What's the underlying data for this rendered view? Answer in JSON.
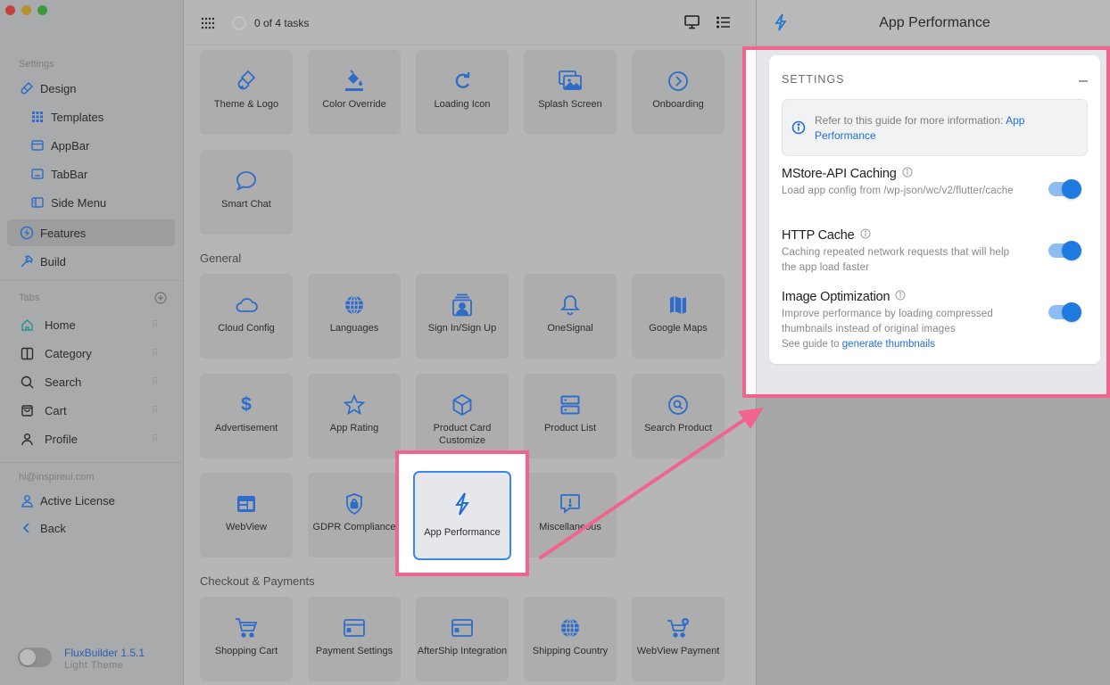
{
  "window": {
    "traffic_lights": [
      "close",
      "minimize",
      "zoom"
    ]
  },
  "sidebar": {
    "settings_label": "Settings",
    "items": [
      {
        "label": "Design",
        "icon": "brush-icon",
        "level": 1,
        "active": false
      },
      {
        "label": "Templates",
        "icon": "grid-icon",
        "level": 2,
        "active": false
      },
      {
        "label": "AppBar",
        "icon": "appbar-icon",
        "level": 2,
        "active": false
      },
      {
        "label": "TabBar",
        "icon": "tabbar-icon",
        "level": 2,
        "active": false
      },
      {
        "label": "Side Menu",
        "icon": "side-menu-icon",
        "level": 2,
        "active": false
      },
      {
        "label": "Features",
        "icon": "bolt-circle-icon",
        "level": 1,
        "active": true
      },
      {
        "label": "Build",
        "icon": "hammer-icon",
        "level": 1,
        "active": false
      }
    ],
    "tabs_label": "Tabs",
    "tabs": [
      {
        "label": "Home",
        "icon": "home-icon"
      },
      {
        "label": "Category",
        "icon": "category-icon"
      },
      {
        "label": "Search",
        "icon": "search-icon"
      },
      {
        "label": "Cart",
        "icon": "cart-icon"
      },
      {
        "label": "Profile",
        "icon": "profile-icon"
      }
    ],
    "email": "hi@inspireui.com",
    "account_items": [
      {
        "label": "Active License",
        "icon": "user-icon"
      },
      {
        "label": "Back",
        "icon": "chevron-left-icon"
      }
    ],
    "app_version": "FluxBuilder 1.5.1",
    "theme_label": "Light Theme",
    "theme_toggle_on": false
  },
  "toolbar": {
    "tasks_text": "0 of 4 tasks",
    "tasks_done": 0,
    "tasks_total": 4
  },
  "main": {
    "design_cards": [
      {
        "label": "Theme & Logo",
        "icon": "brush-icon"
      },
      {
        "label": "Color Override",
        "icon": "paint-bucket-icon"
      },
      {
        "label": "Loading Icon",
        "icon": "refresh-icon"
      },
      {
        "label": "Splash Screen",
        "icon": "images-icon"
      },
      {
        "label": "Onboarding",
        "icon": "arrow-circle-icon"
      },
      {
        "label": "Smart Chat",
        "icon": "chat-icon"
      }
    ],
    "general_label": "General",
    "general_cards": [
      {
        "label": "Cloud Config",
        "icon": "cloud-icon"
      },
      {
        "label": "Languages",
        "icon": "globe-icon"
      },
      {
        "label": "Sign In/Sign Up",
        "icon": "user-card-icon"
      },
      {
        "label": "OneSignal",
        "icon": "bell-icon"
      },
      {
        "label": "Google Maps",
        "icon": "map-icon"
      },
      {
        "label": "Advertisement",
        "icon": "dollar-icon"
      },
      {
        "label": "App Rating",
        "icon": "star-icon"
      },
      {
        "label": "Product Card Customize",
        "icon": "box-icon"
      },
      {
        "label": "Product List",
        "icon": "server-list-icon"
      },
      {
        "label": "Search Product",
        "icon": "search-circle-icon"
      },
      {
        "label": "WebView",
        "icon": "webview-icon"
      },
      {
        "label": "GDPR Compliance",
        "icon": "shield-lock-icon"
      },
      {
        "label": "App Performance",
        "icon": "bolt-icon",
        "selected": true
      },
      {
        "label": "Miscellaneous",
        "icon": "alert-bubble-icon"
      }
    ],
    "checkout_label": "Checkout & Payments",
    "checkout_cards": [
      {
        "label": "Shopping Cart",
        "icon": "cart-icon"
      },
      {
        "label": "Payment Settings",
        "icon": "credit-card-icon"
      },
      {
        "label": "AfterShip Integration",
        "icon": "credit-card-icon"
      },
      {
        "label": "Shipping Country",
        "icon": "globe-icon"
      },
      {
        "label": "WebView Payment",
        "icon": "cart-plus-icon"
      }
    ]
  },
  "panel": {
    "title": "App Performance",
    "section_title": "SETTINGS",
    "info_prefix": "Refer to this guide for more information: ",
    "info_link": "App Performance",
    "options": [
      {
        "title": "MStore-API Caching",
        "desc": "Load app config from /wp-json/wc/v2/flutter/cache",
        "enabled": true
      },
      {
        "title": "HTTP Cache",
        "desc": "Caching repeated network requests that will help the app load faster",
        "enabled": true
      },
      {
        "title": "Image Optimization",
        "desc": "Improve performance by loading compressed thumbnails instead of original images",
        "enabled": true
      }
    ],
    "guide_prefix": "See guide to ",
    "guide_link": "generate thumbnails"
  },
  "annotation": {
    "highlight_color": "#f0648e"
  },
  "colors": {
    "accent": "#2d6cc9",
    "toggle_on": "#1f7ae0",
    "link": "#1f6ed4"
  }
}
